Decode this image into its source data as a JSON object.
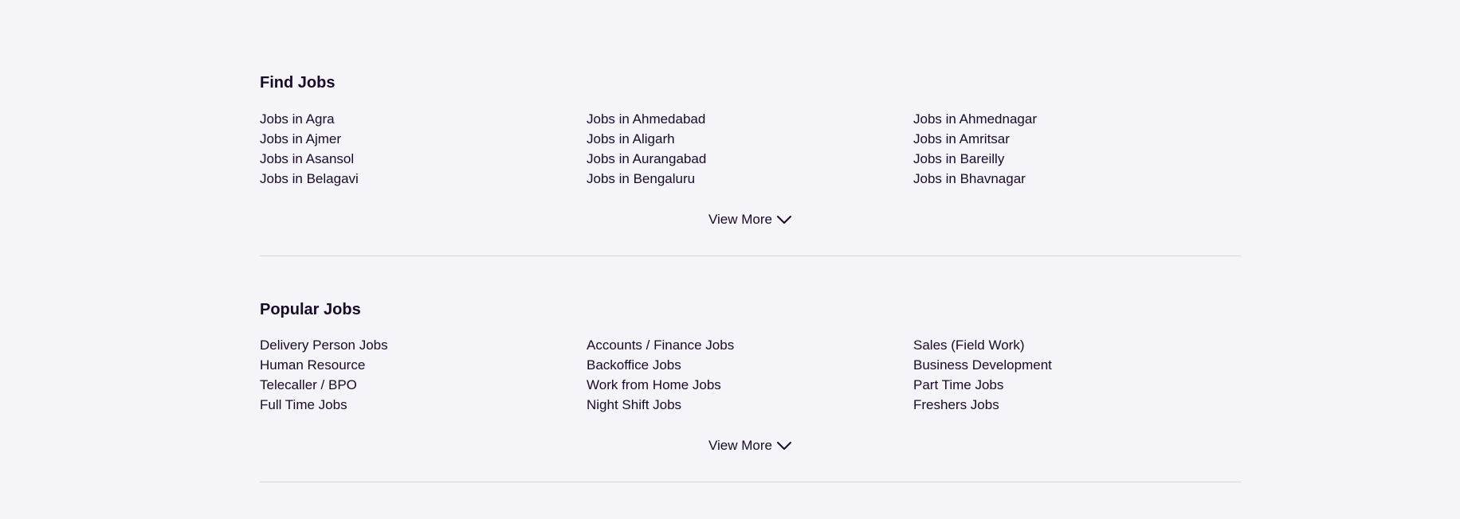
{
  "sections": [
    {
      "title": "Find Jobs",
      "links": [
        "Jobs in Agra",
        "Jobs in Ahmedabad",
        "Jobs in Ahmednagar",
        "Jobs in Ajmer",
        "Jobs in Aligarh",
        "Jobs in Amritsar",
        "Jobs in Asansol",
        "Jobs in Aurangabad",
        "Jobs in Bareilly",
        "Jobs in Belagavi",
        "Jobs in Bengaluru",
        "Jobs in Bhavnagar"
      ],
      "view_more_label": "View More"
    },
    {
      "title": "Popular Jobs",
      "links": [
        "Delivery Person Jobs",
        "Accounts / Finance Jobs",
        "Sales (Field Work)",
        "Human Resource",
        "Backoffice Jobs",
        "Business Development",
        "Telecaller / BPO",
        "Work from Home Jobs",
        "Part Time Jobs",
        "Full Time Jobs",
        "Night Shift Jobs",
        "Freshers Jobs"
      ],
      "view_more_label": "View More"
    }
  ],
  "icons": {
    "view_more": "chevron-down-icon"
  },
  "colors": {
    "background": "#f5f4f8",
    "text": "#190a28",
    "divider": "#d8d6dd"
  }
}
